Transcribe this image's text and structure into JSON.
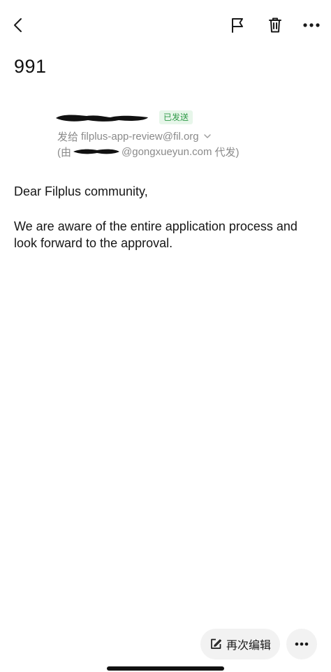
{
  "toolbar": {
    "back_icon": "chevron-left-icon",
    "flag_icon": "flag-icon",
    "delete_icon": "trash-icon",
    "more_icon": "ellipsis-icon"
  },
  "email": {
    "subject": "991",
    "status_badge": "已发送",
    "to_prefix": "发给",
    "to_address": "filplus-app-review@fil.org",
    "via_open": "(由",
    "via_domain": "@gongxueyun.com",
    "via_close": "代发)",
    "body": {
      "greeting": "Dear Filplus community,",
      "paragraph": "We are aware of the entire application process and look forward to the approval."
    }
  },
  "actions": {
    "reedit_label": "再次编辑",
    "reedit_icon": "edit-icon",
    "more_icon": "ellipsis-icon"
  },
  "colors": {
    "badge_bg": "#e7f6ea",
    "badge_text": "#2f9a48",
    "secondary_text": "#8a8a8a",
    "button_bg": "#f2f2f2"
  }
}
